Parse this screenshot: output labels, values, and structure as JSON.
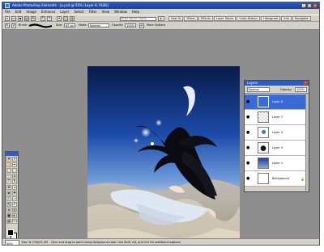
{
  "window": {
    "title": "Adobe Photoshop Elements - [p.psd @ 50% (Layer 8, RGB)]",
    "controls": [
      "_",
      "□",
      "×"
    ]
  },
  "menubar": {
    "items": [
      "File",
      "Edit",
      "Image",
      "Enhance",
      "Layer",
      "Select",
      "Filter",
      "View",
      "Window",
      "Help"
    ]
  },
  "toolbar": {
    "search_placeholder": "Enter search criteria",
    "palette_tabs": [
      "How To",
      "Filters",
      "Effects",
      "Layer Styles",
      "Undo History",
      "Histogram",
      "Info",
      "Navigator"
    ]
  },
  "options_bar": {
    "brush_label": "Brush:",
    "size_label": "Size:",
    "size_value": "65 px",
    "mode_label": "Mode:",
    "mode_value": "Normal",
    "opacity_label": "Opacity:",
    "opacity_value": "100%",
    "more_options_label": "More Options"
  },
  "layers_panel": {
    "title": "Layers",
    "blend_mode": "Normal",
    "opacity_label": "Opacity:",
    "opacity_value": "100%",
    "layers": [
      {
        "name": "Layer 8",
        "active": true
      },
      {
        "name": "Layer 7",
        "active": false
      },
      {
        "name": "Layer 5",
        "active": false
      },
      {
        "name": "Layer 4",
        "active": false
      },
      {
        "name": "Layer 1",
        "active": false
      },
      {
        "name": "Background",
        "active": false
      }
    ]
  },
  "statusbar": {
    "zoom": "50%",
    "doc_size": "Doc: 8.77M/33.2M",
    "hint": "Click and drag to paint using foreground color. Use Shift, Alt, and Ctrl for additional options."
  },
  "colors": {
    "title_blue": "#2a5cc8",
    "panel_grey": "#d4d0c8",
    "workspace_grey": "#8e8e8e",
    "active_layer": "#3a6ad6",
    "foreground": "#000000",
    "background": "#ffffff"
  },
  "icons": [
    "brush-icon",
    "eye-icon",
    "lock-icon",
    "move-tool-icon",
    "zoom-tool-icon",
    "hand-tool-icon",
    "eyedropper-tool-icon",
    "marquee-tool-icon",
    "lasso-tool-icon",
    "magic-wand-tool-icon",
    "type-tool-icon",
    "crop-tool-icon",
    "paint-bucket-tool-icon",
    "gradient-tool-icon",
    "eraser-tool-icon",
    "clone-stamp-tool-icon",
    "blur-tool-icon",
    "shape-tool-icon",
    "sponge-tool-icon"
  ]
}
